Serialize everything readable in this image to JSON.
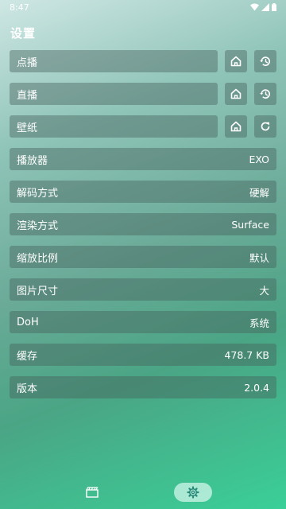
{
  "status_bar": {
    "time": "8:47",
    "icons": [
      "wifi-icon",
      "signal-icon",
      "battery-icon"
    ]
  },
  "page_title": "设置",
  "rows": [
    {
      "label": "点播",
      "value": "",
      "buttons": [
        "home-icon",
        "history-icon"
      ]
    },
    {
      "label": "直播",
      "value": "",
      "buttons": [
        "home-icon",
        "history-icon"
      ]
    },
    {
      "label": "壁纸",
      "value": "",
      "buttons": [
        "home-icon",
        "refresh-icon"
      ]
    },
    {
      "label": "播放器",
      "value": "EXO"
    },
    {
      "label": "解码方式",
      "value": "硬解"
    },
    {
      "label": "渲染方式",
      "value": "Surface"
    },
    {
      "label": "缩放比例",
      "value": "默认"
    },
    {
      "label": "图片尺寸",
      "value": "大"
    },
    {
      "label": "DoH",
      "value": "系统"
    },
    {
      "label": "缓存",
      "value": "478.7 KB"
    },
    {
      "label": "版本",
      "value": "2.0.4"
    }
  ],
  "bottom_nav": {
    "items": [
      "film-icon",
      "gear-icon"
    ],
    "selected": "gear-icon"
  }
}
